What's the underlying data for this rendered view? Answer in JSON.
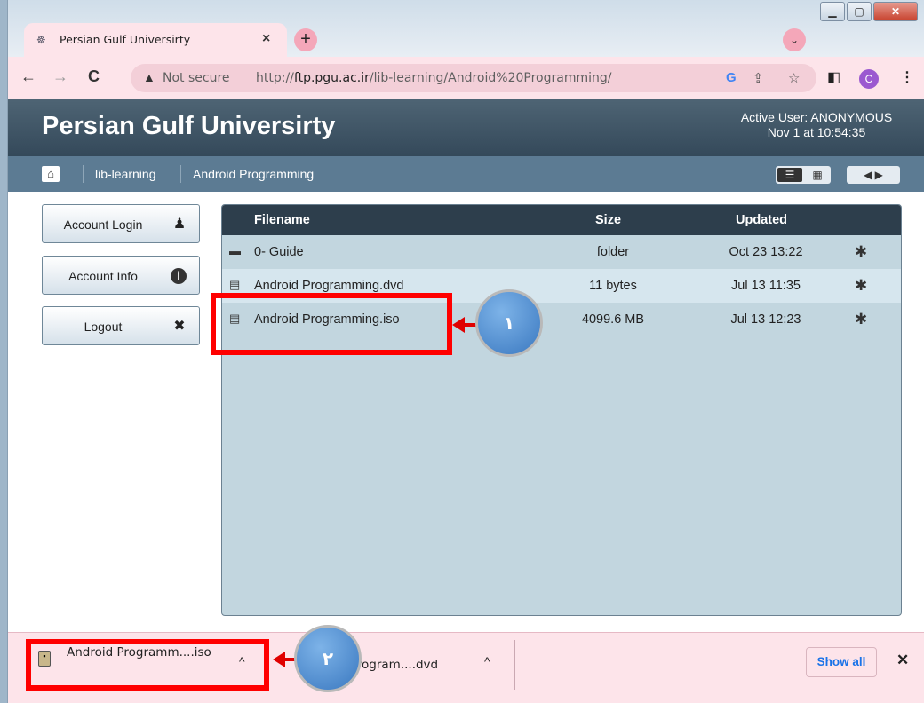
{
  "browser": {
    "tab": {
      "title": "Persian Gulf Universirty",
      "close": "×",
      "new_tab": "+",
      "tab_search": "⌄"
    },
    "window_controls": {
      "minimize": "▁",
      "maximize": "▢",
      "close": "✕"
    },
    "nav": {
      "back": "←",
      "forward": "→",
      "reload": "C"
    },
    "omnibox": {
      "security_icon": "▲",
      "security_label": "Not secure",
      "url_prefix": "http://",
      "url_host": "ftp.pgu.ac.ir",
      "url_path": "/lib-learning/Android%20Programming/"
    },
    "toolbar_icons": {
      "google": "G",
      "share": "⇪",
      "bookmark": "☆",
      "sidepanel": "◧",
      "profile": "C",
      "menu": "⋮"
    }
  },
  "site": {
    "brand": "Persian Gulf Universirty",
    "active_user": "Active User: ANONYMOUS",
    "datetime": "Nov 1 at 10:54:35",
    "breadcrumbs": [
      "lib-learning",
      "Android Programming"
    ],
    "view_toggle": {
      "list": "☰",
      "grid": "▦"
    },
    "nav_arrows": "◀ ▶"
  },
  "sidebar": {
    "buttons": [
      {
        "label": "Account Login",
        "icon": "user-icon",
        "glyph": "♟"
      },
      {
        "label": "Account Info",
        "icon": "info-icon",
        "glyph": "i"
      },
      {
        "label": "Logout",
        "icon": "close-icon",
        "glyph": "✖"
      }
    ]
  },
  "files": {
    "headers": {
      "name": "Filename",
      "size": "Size",
      "updated": "Updated"
    },
    "rows": [
      {
        "name": "0- Guide",
        "size": "folder",
        "updated": "Oct 23 13:22",
        "type": "folder"
      },
      {
        "name": "Android Programming.dvd",
        "size": "11 bytes",
        "updated": "Jul 13 11:35",
        "type": "file"
      },
      {
        "name": "Android Programming.iso",
        "size": "4099.6 MB",
        "updated": "Jul 13 12:23",
        "type": "file"
      }
    ]
  },
  "downloads": {
    "items": [
      {
        "name": "Android Programm....iso",
        "chevron": "^"
      },
      {
        "name": "d Program....dvd",
        "chevron": "^"
      }
    ],
    "show_all": "Show all",
    "close": "✕"
  },
  "annotations": {
    "callout_1": "١",
    "callout_2": "٢",
    "highlight_color": "#ff0000",
    "callout_color": "#3a78c0"
  }
}
